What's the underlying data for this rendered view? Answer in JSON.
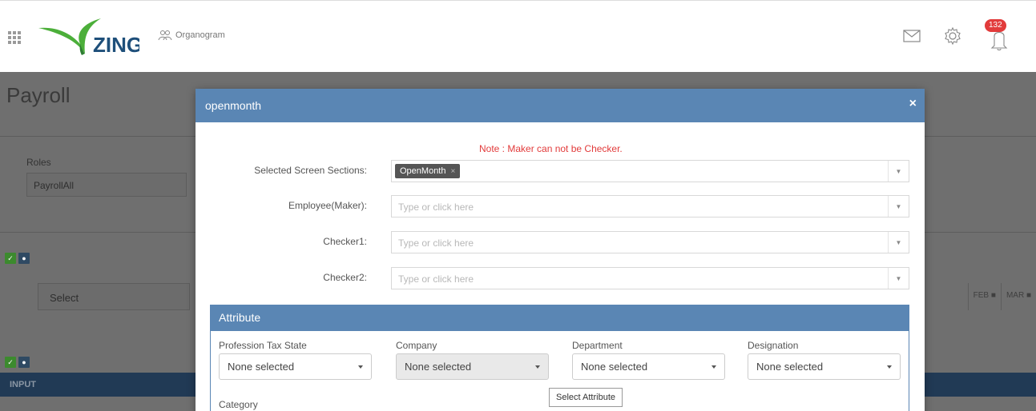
{
  "topbar": {
    "brand": "ZING",
    "org_link": "Organogram",
    "notification_count": "132"
  },
  "background": {
    "page_title": "Payroll",
    "roles_label": "Roles",
    "roles_value": "PayrollAll",
    "select_placeholder": "Select",
    "months": [
      "FEB",
      "MAR"
    ],
    "input_bar": "INPUT"
  },
  "modal": {
    "title": "openmonth",
    "close": "×",
    "note": "Note : Maker can not be Checker.",
    "fields": {
      "sections_label": "Selected Screen Sections:",
      "sections_tag": "OpenMonth",
      "maker_label": "Employee(Maker):",
      "checker1_label": "Checker1:",
      "checker2_label": "Checker2:",
      "placeholder": "Type or click here"
    },
    "attribute": {
      "title": "Attribute",
      "fields": [
        {
          "label": "Profession Tax State",
          "value": "None selected"
        },
        {
          "label": "Company",
          "value": "None selected"
        },
        {
          "label": "Department",
          "value": "None selected"
        },
        {
          "label": "Designation",
          "value": "None selected"
        }
      ],
      "category_label": "Category",
      "select_attribute": "Select Attribute"
    }
  },
  "colors": {
    "modal_header": "#5a86b4",
    "note": "#e23b3b",
    "badge": "#e23b3b",
    "brand_green": "#4caf3a"
  }
}
